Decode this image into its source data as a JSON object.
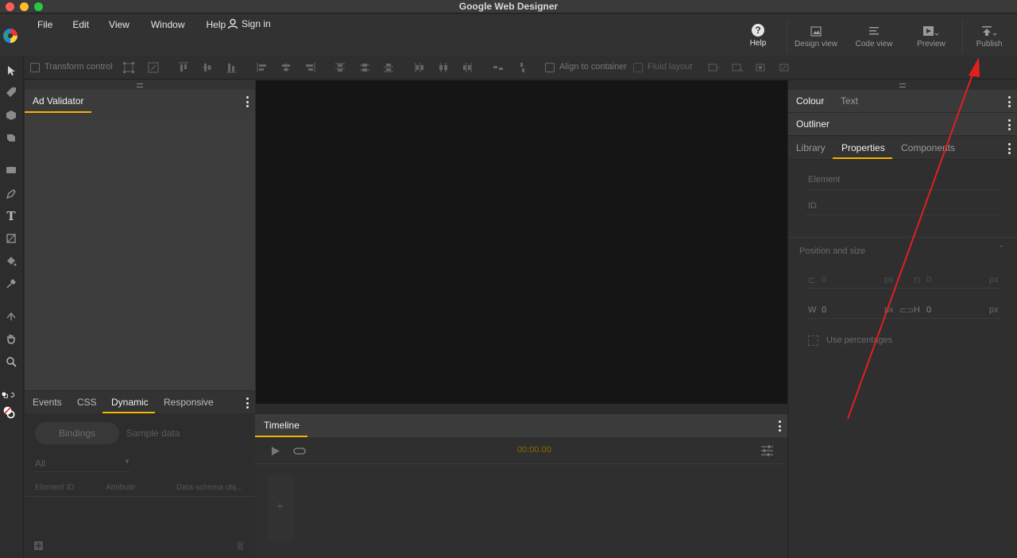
{
  "window": {
    "title": "Google Web Designer"
  },
  "menu": {
    "items": [
      "File",
      "Edit",
      "View",
      "Window",
      "Help"
    ],
    "signin_label": "Sign in"
  },
  "header_buttons": {
    "help": "Help",
    "design_view": "Design view",
    "code_view": "Code view",
    "preview": "Preview",
    "publish": "Publish"
  },
  "toolbar": {
    "transform_control": "Transform control",
    "align_to_container": "Align to container",
    "fluid_layout": "Fluid layout"
  },
  "left_panel": {
    "title": "Ad Validator",
    "bottom_tabs": [
      "Events",
      "CSS",
      "Dynamic",
      "Responsive"
    ],
    "active_bottom_tab": "Dynamic",
    "bindings_label": "Bindings",
    "sample_data_label": "Sample data",
    "filter_value": "All",
    "columns": [
      "Element ID",
      "Attribute",
      "Data schema obj..."
    ]
  },
  "timeline": {
    "title": "Timeline",
    "time": "00:00.00"
  },
  "right_panel": {
    "tabs_top": [
      "Colour",
      "Text"
    ],
    "outliner": "Outliner",
    "tabs_main": [
      "Library",
      "Properties",
      "Components"
    ],
    "active_main_tab": "Properties",
    "element_label": "Element",
    "id_label": "ID",
    "position_size_label": "Position and size",
    "x_value": "0",
    "y_value": "0",
    "w_label": "W",
    "w_value": "0",
    "h_label": "H",
    "h_value": "0",
    "unit": "px",
    "use_percentages": "Use percentages"
  },
  "colors": {
    "accent": "#f3b300",
    "annotation_arrow": "#e02020"
  }
}
